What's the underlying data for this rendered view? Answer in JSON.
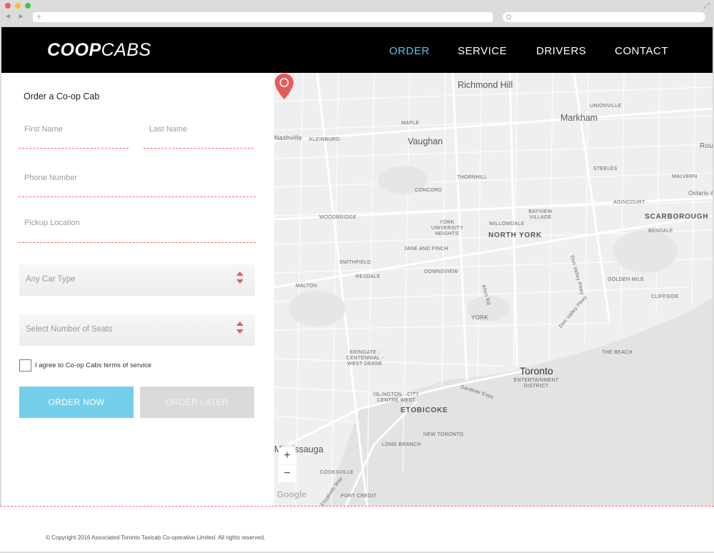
{
  "browser": {
    "url_plus": "+",
    "back_forward": "◀ ▶",
    "expand": "⤢"
  },
  "header": {
    "logo_bold": "COOP",
    "logo_light": "CABS",
    "nav": [
      "ORDER",
      "SERVICE",
      "DRIVERS",
      "CONTACT"
    ],
    "active_nav": "ORDER",
    "accent_color": "#5ec4e6"
  },
  "form": {
    "title": "Order a Co-op Cab",
    "first_name_placeholder": "First Name",
    "last_name_placeholder": "Last Name",
    "phone_placeholder": "Phone Number",
    "pickup_placeholder": "Pickup Location",
    "car_type_selected": "Any Car Type",
    "seats_selected": "Select Number of Seats",
    "terms_label": "I agree to Co-op Cabs terms of service",
    "order_now_label": "ORDER NOW",
    "order_later_label": "ORDER LATER",
    "order_now_color": "#74cfea",
    "order_later_color": "#dadada"
  },
  "map": {
    "labels": {
      "richmond_hill": "Richmond Hill",
      "unionville": "UNIONVILLE",
      "markham": "Markham",
      "maple": "MAPLE",
      "nashville": "Nashville",
      "kleinburg": "KLEINBURG",
      "vaughan": "Vaughan",
      "rou": "Rou",
      "thornhill": "THORNHILL",
      "steeles": "STEELES",
      "malvern": "MALVERN",
      "concord": "CONCORD",
      "ontario": "Ontario 4",
      "agincourt": "AGINCOURT",
      "bayview_village": "BAYVIEW VILLAGE",
      "scarborough": "SCARBOROUGH",
      "woodbridge": "WOODBRIDGE",
      "york_university": "YORK UNIVERSITY HEIGHTS",
      "willowdale": "WILLOWDALE",
      "bendale": "BENDALE",
      "north_york": "NORTH YORK",
      "jane_and_finch": "JANE AND FINCH",
      "don_valley_pkwy": "Don Valley Pkwy",
      "smithfield": "SMITHFIELD",
      "downsview": "DOWNSVIEW",
      "rexdale": "REXDALE",
      "malton": "MALTON",
      "golden_mile": "GOLDEN MILE",
      "allen_rd": "Allen Rd",
      "cliffside": "CLIFFSIDE",
      "york": "YORK",
      "don_valley_pkwy2": "Don Valley Pkwy",
      "the_beach": "THE BEACH",
      "eringate": "ERINGATE - CENTENNIAL - WEST DEANE",
      "toronto": "Toronto",
      "entertainment": "ENTERTAINMENT DISTRICT",
      "gardiner": "Gardiner Expy",
      "islington": "ISLINGTON - CITY CENTRE WEST",
      "etobicoke": "ETOBICOKE",
      "new_toronto": "NEW TORONTO",
      "mississauga": "Mississauga",
      "long_branch": "LONG BRANCH",
      "cooksville": "COOKSVILLE",
      "port_credit": "PORT CREDIT",
      "elizabeth_way": "Elizabeth Way",
      "google": "Google"
    },
    "zoom_in": "+",
    "zoom_out": "−",
    "pin_color": "#e55a5a"
  },
  "footer": {
    "copyright": "© Copyright 2016 Associated Toronto Taxicab Co-operative Limited. All rights reserved."
  }
}
